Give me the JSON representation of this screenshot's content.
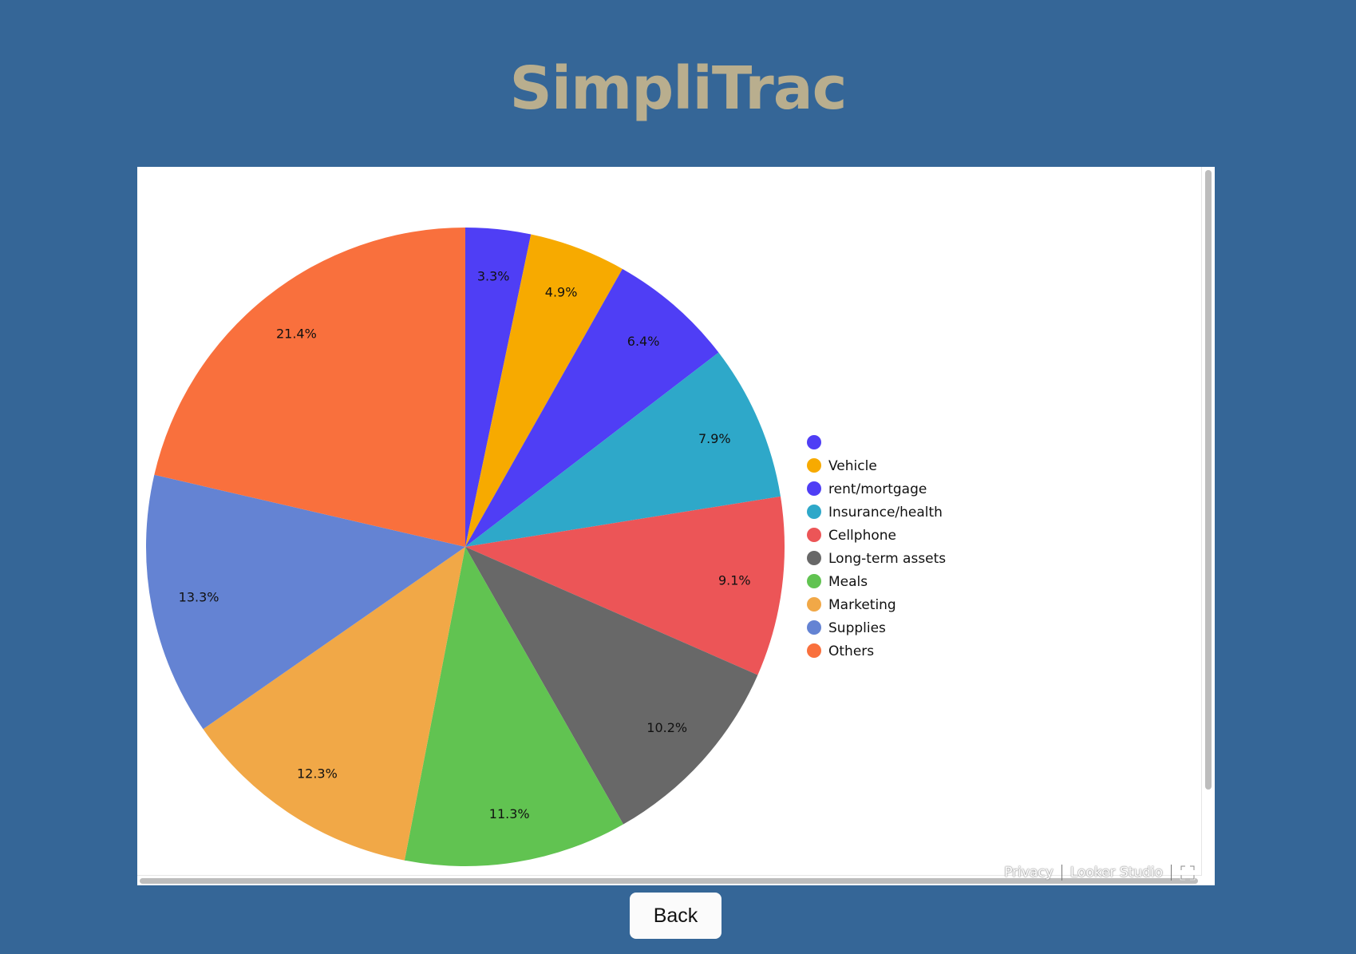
{
  "app": {
    "title": "SimpliTrac"
  },
  "chart_data": {
    "type": "pie",
    "categories": [
      "",
      "Vehicle",
      "rent/mortgage",
      "Insurance/health",
      "Cellphone",
      "Long-term assets",
      "Meals",
      "Marketing",
      "Supplies",
      "Others"
    ],
    "values": [
      3.3,
      4.9,
      6.4,
      7.9,
      9.1,
      10.2,
      11.3,
      12.3,
      13.3,
      21.4
    ],
    "labels": [
      "3.3%",
      "4.9%",
      "6.4%",
      "7.9%",
      "9.1%",
      "10.2%",
      "11.3%",
      "12.3%",
      "13.3%",
      "21.4%"
    ],
    "colors": [
      "#4f3ef5",
      "#f7aa00",
      "#4f3ef5",
      "#2ea8c9",
      "#ec5557",
      "#686868",
      "#61c351",
      "#f1a847",
      "#6483d3",
      "#f9703d"
    ],
    "legend_position": "right"
  },
  "footer": {
    "privacy_label": "Privacy",
    "looker_label": "Looker Studio"
  },
  "back_button": {
    "label": "Back"
  }
}
